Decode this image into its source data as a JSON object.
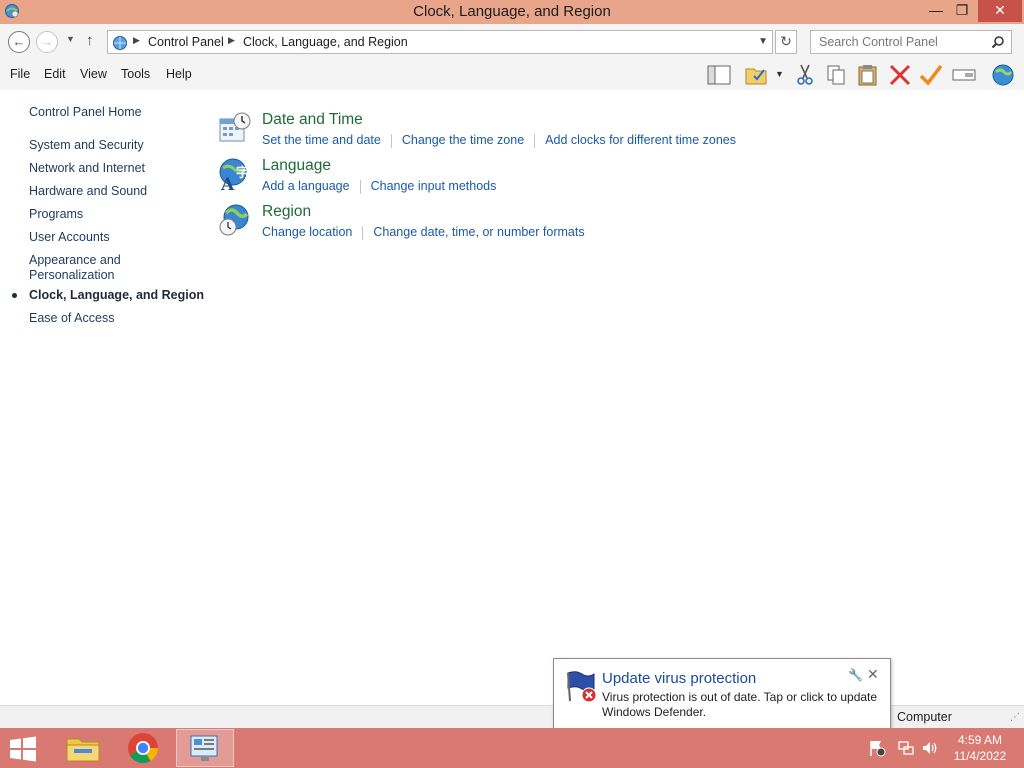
{
  "window": {
    "title": "Clock, Language, and Region",
    "close_glyph": "✕",
    "max_glyph": "❐",
    "min_glyph": "—"
  },
  "address": {
    "crumbs": [
      "Control Panel",
      "Clock, Language, and Region"
    ],
    "search_placeholder": "Search Control Panel"
  },
  "menu": {
    "items": [
      "File",
      "Edit",
      "View",
      "Tools",
      "Help"
    ]
  },
  "toolbar": {
    "icons": [
      "layout-pane-icon",
      "folder-check-icon",
      "cut-icon",
      "copy-icon",
      "paste-icon",
      "delete-icon",
      "checkmark-icon",
      "rename-icon",
      "globe-icon"
    ]
  },
  "sidebar": {
    "items": [
      {
        "label": "Control Panel Home"
      },
      {
        "label": "System and Security"
      },
      {
        "label": "Network and Internet"
      },
      {
        "label": "Hardware and Sound"
      },
      {
        "label": "Programs"
      },
      {
        "label": "User Accounts"
      },
      {
        "label": "Appearance and Personalization"
      },
      {
        "label": "Clock, Language, and Region",
        "current": true
      },
      {
        "label": "Ease of Access"
      }
    ]
  },
  "categories": [
    {
      "title": "Date and Time",
      "links": [
        "Set the time and date",
        "Change the time zone",
        "Add clocks for different time zones"
      ]
    },
    {
      "title": "Language",
      "links": [
        "Add a language",
        "Change input methods"
      ]
    },
    {
      "title": "Region",
      "links": [
        "Change location",
        "Change date, time, or number formats"
      ]
    }
  ],
  "statusbar": {
    "text": "Computer"
  },
  "balloon": {
    "title": "Update virus protection",
    "message": "Virus protection is out of date. Tap or click to update Windows Defender."
  },
  "taskbar": {
    "time": "4:59 AM",
    "date": "11/4/2022",
    "apps": [
      "File Explorer",
      "Google Chrome",
      "Control Panel"
    ]
  },
  "colors": {
    "titlebar": "#e9a58a",
    "taskbar": "#d87a72",
    "link": "#1a5aa6",
    "category_title": "#1e6b38"
  }
}
